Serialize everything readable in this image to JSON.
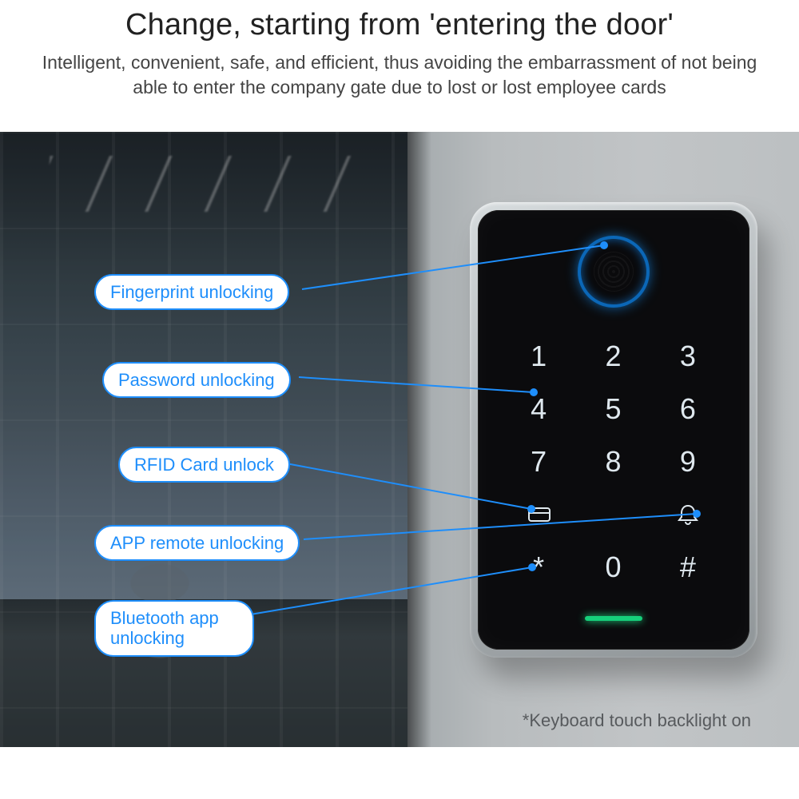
{
  "header": {
    "title": "Change, starting from 'entering the door'",
    "subtitle": "Intelligent, convenient, safe, and efficient, thus avoiding the embarrassment of not being able to enter the company gate due to lost or lost employee cards"
  },
  "callouts": {
    "fingerprint": "Fingerprint unlocking",
    "password": "Password unlocking",
    "rfid": "RFID Card unlock",
    "app": "APP remote unlocking",
    "bluetooth": "Bluetooth app unlocking"
  },
  "keypad": {
    "rows": [
      [
        "1",
        "2",
        "3"
      ],
      [
        "4",
        "5",
        "6"
      ],
      [
        "7",
        "8",
        "9"
      ],
      [
        "*",
        "0",
        "#"
      ]
    ],
    "card_icon_name": "card-icon",
    "bell_icon_name": "doorbell-icon"
  },
  "caption": "*Keyboard touch backlight on",
  "colors": {
    "accent": "#1e8efb",
    "led": "#16d07b"
  }
}
